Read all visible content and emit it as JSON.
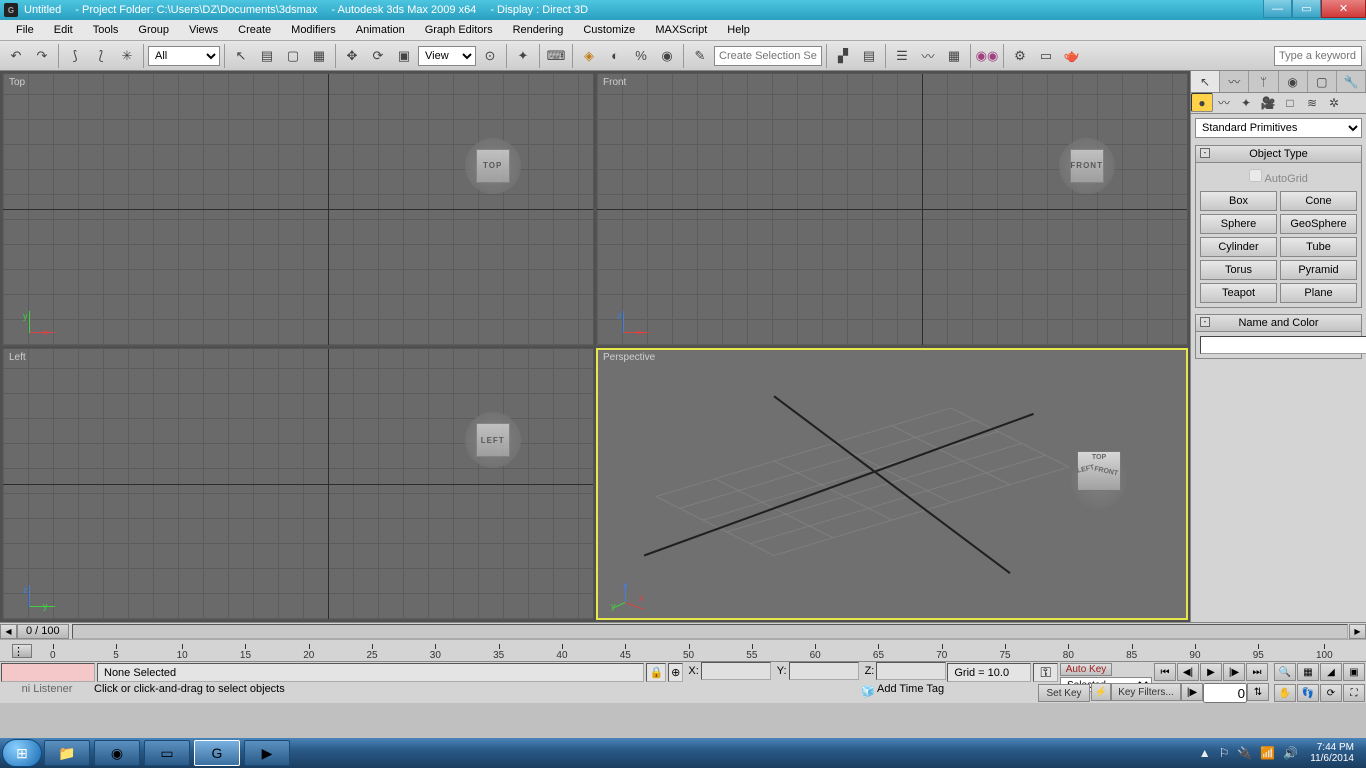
{
  "title_parts": {
    "doc": "Untitled",
    "folder": "- Project Folder: C:\\Users\\DZ\\Documents\\3dsmax",
    "app": "- Autodesk 3ds Max  2009 x64",
    "display": "- Display : Direct 3D"
  },
  "menu": [
    "File",
    "Edit",
    "Tools",
    "Group",
    "Views",
    "Create",
    "Modifiers",
    "Animation",
    "Graph Editors",
    "Rendering",
    "Customize",
    "MAXScript",
    "Help"
  ],
  "toolbar": {
    "selset_drop": "All",
    "view_drop": "View",
    "named_sel": "Create Selection Set",
    "search_placeholder": "Type a keyword or"
  },
  "viewports": [
    "Top",
    "Front",
    "Left",
    "Perspective"
  ],
  "viewcube": {
    "top": "TOP",
    "front": "FRONT",
    "left": "LEFT"
  },
  "cmdpanel": {
    "category_drop": "Standard Primitives",
    "rollout_objtype": "Object Type",
    "autogrid": "AutoGrid",
    "prims": [
      [
        "Box",
        "Cone"
      ],
      [
        "Sphere",
        "GeoSphere"
      ],
      [
        "Cylinder",
        "Tube"
      ],
      [
        "Torus",
        "Pyramid"
      ],
      [
        "Teapot",
        "Plane"
      ]
    ],
    "rollout_namecolor": "Name and Color",
    "name_value": ""
  },
  "scroll": {
    "frame_badge": "0 / 100"
  },
  "timeline_ticks": [
    0,
    5,
    10,
    15,
    20,
    25,
    30,
    35,
    40,
    45,
    50,
    55,
    60,
    65,
    70,
    75,
    80,
    85,
    90,
    95,
    100
  ],
  "status": {
    "sel": "None Selected",
    "x_label": "X:",
    "y_label": "Y:",
    "z_label": "Z:",
    "x": "",
    "y": "",
    "z": "",
    "grid": "Grid = 10.0",
    "autokey": "Auto Key",
    "setkey": "Set Key",
    "keymode": "Selected",
    "keyfilters": "Key Filters...",
    "frame": "0",
    "timetag": "Add Time Tag",
    "listener": "ni Listener",
    "prompt": "Click or click-and-drag to select objects"
  },
  "tray": {
    "time": "7:44 PM",
    "date": "11/6/2014"
  }
}
